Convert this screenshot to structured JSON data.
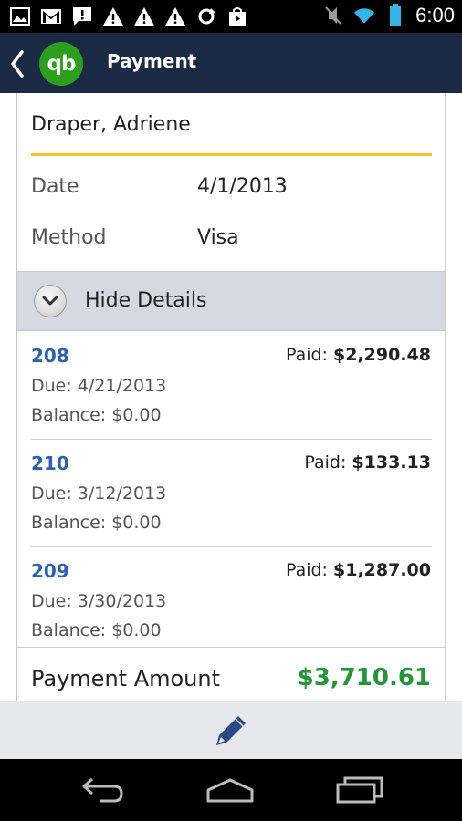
{
  "status_bar": {
    "time": "6:00",
    "left_icons": [
      "image-notification-icon",
      "gmail-icon",
      "chat-alert-icon",
      "warning-icon",
      "warning-icon",
      "warning-icon",
      "sync-icon",
      "shopping-bag-icon"
    ],
    "right_icons": [
      "mute-icon",
      "wifi-icon",
      "battery-icon"
    ]
  },
  "action_bar": {
    "back_icon": "chevron-left-icon",
    "logo_text": "qb",
    "title": "Payment",
    "colors": {
      "background": "#1b2a44",
      "logo": "#2ca01c"
    }
  },
  "payment": {
    "customer": "Draper, Adriene",
    "date_label": "Date",
    "date_value": "4/1/2013",
    "method_label": "Method",
    "method_value": "Visa"
  },
  "details_toggle": {
    "label": "Hide Details",
    "icon": "chevron-down-circle-icon"
  },
  "invoices": [
    {
      "number": "208",
      "paid_label": "Paid:",
      "paid_amount": "$2,290.48",
      "due": "Due: 4/21/2013",
      "balance": "Balance: $0.00"
    },
    {
      "number": "210",
      "paid_label": "Paid:",
      "paid_amount": "$133.13",
      "due": "Due: 3/12/2013",
      "balance": "Balance: $0.00"
    },
    {
      "number": "209",
      "paid_label": "Paid:",
      "paid_amount": "$1,287.00",
      "due": "Due: 3/30/2013",
      "balance": "Balance: $0.00"
    }
  ],
  "total": {
    "label": "Payment Amount",
    "amount": "$3,710.61",
    "color": "#24963a"
  },
  "bottom_bar": {
    "edit_icon": "pencil-icon"
  },
  "nav_bar": {
    "icons": [
      "back-icon",
      "home-icon",
      "recent-apps-icon"
    ]
  }
}
